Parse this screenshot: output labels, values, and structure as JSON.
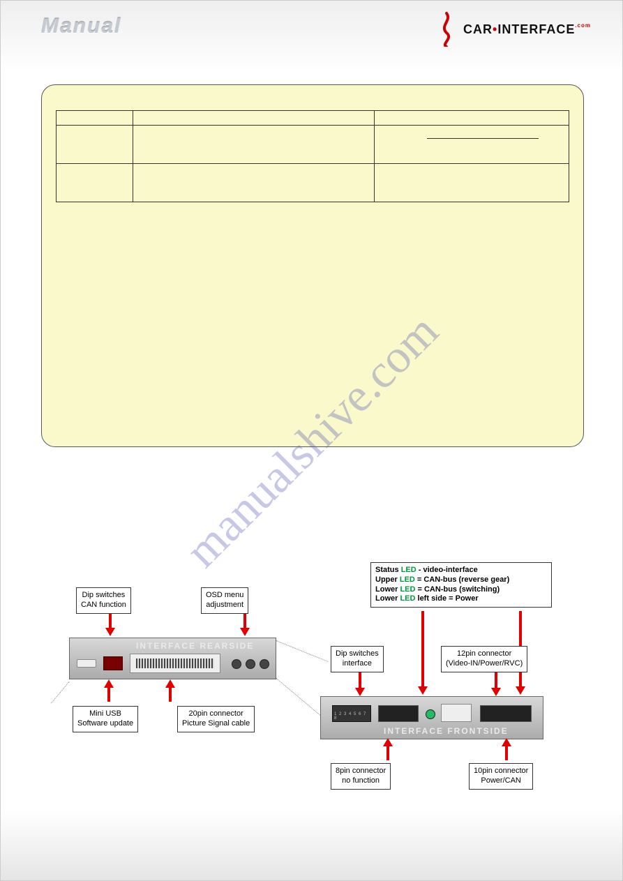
{
  "header": {
    "manual_word": "Manual",
    "logo_left": "CAR",
    "logo_right": "INTERFACE",
    "logo_suffix": ".com"
  },
  "watermark": "manualshive.com",
  "panel": {
    "rows": [
      {
        "c1": "",
        "c2": "",
        "c3": ""
      },
      {
        "c1": "",
        "c2": "",
        "c3_underlined": ""
      },
      {
        "c1": "",
        "c2": "",
        "c3": ""
      }
    ]
  },
  "diagram": {
    "rear": {
      "title": "INTERFACE REARSIDE",
      "label_dip_can": "Dip switches\nCAN function",
      "label_osd": "OSD menu\nadjustment",
      "label_miniusb": "Mini USB\nSoftware update",
      "label_20pin": "20pin connector\nPicture Signal cable"
    },
    "front": {
      "title": "INTERFACE FRONTSIDE",
      "label_dip_if": "Dip switches\ninterface",
      "label_12pin": "12pin connector\n(Video-IN/Power/RVC)",
      "label_8pin": "8pin connector\nno function",
      "label_10pin": "10pin connector\nPower/CAN",
      "status_lines": [
        {
          "prefix": "Status ",
          "led": "LED",
          "suffix": " - video-interface"
        },
        {
          "prefix": "Upper ",
          "led": "LED",
          "suffix": " = CAN-bus (reverse gear)"
        },
        {
          "prefix": "Lower ",
          "led": "LED",
          "suffix": " = CAN-bus (switching)"
        },
        {
          "prefix": "Lower ",
          "led": "LED",
          "suffix": " left side = Power"
        }
      ]
    }
  }
}
